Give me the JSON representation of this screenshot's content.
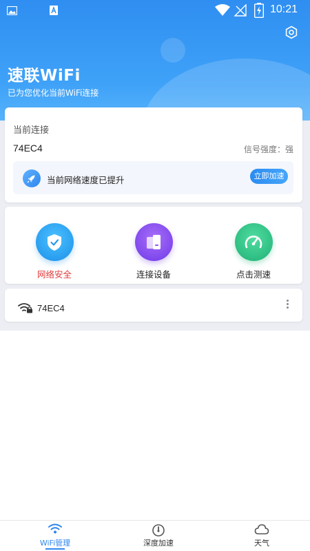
{
  "status_bar": {
    "time": "10:21"
  },
  "header": {
    "title": "速联WiFi",
    "subtitle": "已为您优化当前WiFi连接"
  },
  "connection_card": {
    "label": "当前连接",
    "ssid": "74EC4",
    "signal_text": "信号强度：强",
    "boost_text": "当前网络速度已提升",
    "boost_button": "立即加速"
  },
  "tools": [
    {
      "label": "网络安全",
      "icon": "shield-check-icon",
      "color": "#e23b3b"
    },
    {
      "label": "连接设备",
      "icon": "devices-icon"
    },
    {
      "label": "点击测速",
      "icon": "speedometer-icon"
    }
  ],
  "network_list": [
    {
      "ssid": "74EC4",
      "icon": "wifi-lock-icon"
    }
  ],
  "bottom_nav": {
    "items": [
      {
        "label": "WiFi管理",
        "icon": "wifi-icon",
        "active": true
      },
      {
        "label": "深度加速",
        "icon": "boost-gauge-icon"
      },
      {
        "label": "天气",
        "icon": "cloud-icon"
      }
    ]
  },
  "colors": {
    "accent": "#2f86ee",
    "security": "#e23b3b"
  }
}
